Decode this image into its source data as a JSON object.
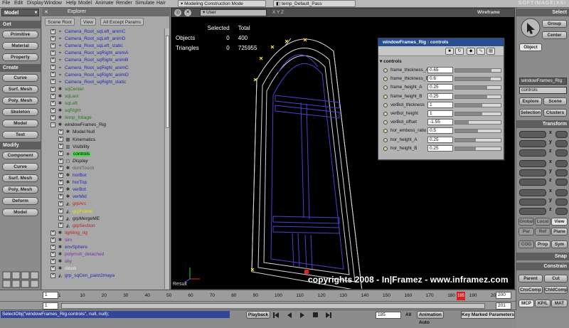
{
  "menubar": {
    "items": [
      "File",
      "Edit",
      "Display",
      "Window",
      "Help",
      "Model",
      "Animate",
      "Render",
      "Simulate",
      "Hair"
    ],
    "mode": "Modeling Construction Mode",
    "pass": "temp_Default_Pass",
    "brand": "SOFTIMAGE|XSI"
  },
  "lefttb": {
    "module": "Model",
    "sections": {
      "get": "Get",
      "create": "Create",
      "modify": "Modify"
    },
    "get_buttons": [
      "Primitive",
      "Material",
      "Property"
    ],
    "create_buttons": [
      "Curve",
      "Surf. Mesh",
      "Poly. Mesh",
      "Skeleton",
      "Model",
      "Text"
    ],
    "modify_buttons": [
      "Component",
      "Curve",
      "Surf. Mesh",
      "Poly. Mesh",
      "Deform",
      "Model"
    ]
  },
  "explorer": {
    "title": "Explorer",
    "tabs": [
      "Scene Root",
      "View",
      "All Except Params"
    ],
    "rows": [
      {
        "label": "Camera_Root_sqLeft_animC",
        "icon": "camera-icon",
        "depth": 0,
        "color": "#2323b8"
      },
      {
        "label": "Camera_Root_sqLeft_animD",
        "icon": "camera-icon",
        "depth": 0,
        "color": "#2323b8"
      },
      {
        "label": "Camera_Root_sqLeft_static",
        "icon": "camera-icon",
        "depth": 0,
        "color": "#2323b8"
      },
      {
        "label": "Camera_Root_sqRight_animA",
        "icon": "camera-icon",
        "depth": 0,
        "color": "#2323b8"
      },
      {
        "label": "Camera_Root_sqRight_animB",
        "icon": "camera-icon",
        "depth": 0,
        "color": "#2323b8"
      },
      {
        "label": "Camera_Root_sqRight_animC",
        "icon": "camera-icon",
        "depth": 0,
        "color": "#2323b8"
      },
      {
        "label": "Camera_Root_sqRight_animD",
        "icon": "camera-icon",
        "depth": 0,
        "color": "#2323b8"
      },
      {
        "label": "Camera_Root_sqRight_static",
        "icon": "camera-icon",
        "depth": 0,
        "color": "#2323b8"
      },
      {
        "label": "sqCenter",
        "icon": "null-icon",
        "depth": 0,
        "color": "#1f7a1f"
      },
      {
        "label": "sqLast",
        "icon": "null-icon",
        "depth": 0,
        "color": "#1f7a1f"
      },
      {
        "label": "sqLeft",
        "icon": "null-icon",
        "depth": 0,
        "color": "#1f7a1f"
      },
      {
        "label": "sqRight",
        "icon": "null-icon",
        "depth": 0,
        "color": "#1f7a1f"
      },
      {
        "label": "temp_foliage",
        "icon": "null-icon",
        "depth": 0,
        "color": "#1f7a1f"
      },
      {
        "label": "windowFrames_Rig",
        "icon": "null-icon",
        "depth": 0,
        "color": "#111111",
        "expanded": true
      },
      {
        "label": "Model Null",
        "icon": "null-icon",
        "depth": 1,
        "color": "#111111"
      },
      {
        "label": "Kinematics",
        "icon": "kinematics-icon",
        "depth": 1,
        "color": "#111111"
      },
      {
        "label": "Visibility",
        "icon": "visibility-icon",
        "depth": 1,
        "color": "#111111"
      },
      {
        "label": "controls",
        "icon": "property-icon",
        "depth": 1,
        "color": "#000000",
        "selected": true
      },
      {
        "label": "Display",
        "icon": "display-icon",
        "depth": 1,
        "color": "#111111",
        "italic": true
      },
      {
        "label": "dontTouch",
        "icon": "null-icon",
        "depth": 1,
        "color": "#5a5a5a"
      },
      {
        "label": "horBot",
        "icon": "null-icon",
        "depth": 1,
        "color": "#2323b8"
      },
      {
        "label": "horTop",
        "icon": "null-icon",
        "depth": 1,
        "color": "#2323b8"
      },
      {
        "label": "verBot",
        "icon": "null-icon",
        "depth": 1,
        "color": "#2323b8"
      },
      {
        "label": "verMid",
        "icon": "null-icon",
        "depth": 1,
        "color": "#2323b8"
      },
      {
        "label": "grpArc",
        "icon": "group-icon",
        "depth": 1,
        "color": "#c02020"
      },
      {
        "label": "grpFrame",
        "icon": "group-icon",
        "depth": 1,
        "color": "#e6e000"
      },
      {
        "label": "grpMergeME",
        "icon": "group-icon",
        "depth": 1,
        "color": "#111111"
      },
      {
        "label": "grpSection",
        "icon": "group-icon",
        "depth": 1,
        "color": "#c02020"
      },
      {
        "label": "lighting_rig",
        "icon": "null-icon",
        "depth": 0,
        "color": "#c02020"
      },
      {
        "label": "sim",
        "icon": "null-icon",
        "depth": 0,
        "color": "#7a2fb0"
      },
      {
        "label": "envSphere",
        "icon": "null-icon",
        "depth": 0,
        "color": "#2323b8"
      },
      {
        "label": "polymsh_detached",
        "icon": "null-icon",
        "depth": 0,
        "color": "#7a2fb0"
      },
      {
        "label": "sky",
        "icon": "null-icon",
        "depth": 0,
        "color": "#7a2fb0"
      },
      {
        "label": "cloud",
        "icon": "null-icon",
        "depth": 0,
        "color": "#f0f0f0"
      },
      {
        "label": "grp_sqCen_paint2maya",
        "icon": "group-icon",
        "depth": 0,
        "color": "#2323b8"
      }
    ]
  },
  "viewport": {
    "camera": "User",
    "shading": "Wireframe",
    "stats": {
      "col1": "Selected",
      "col2": "Total",
      "rows": [
        [
          "Objects",
          "0",
          "400"
        ],
        [
          "Triangles",
          "0",
          "725955"
        ]
      ]
    },
    "copyright": "copyrights 2008 - In|Framez - www.inframez.com",
    "result_label": "Result"
  },
  "ppg": {
    "title": "windowFrames_Rig : controls",
    "section": "controls",
    "params": [
      {
        "name": "frame_thickness_A",
        "value": "0.65",
        "level": 0.8
      },
      {
        "name": "frame_thickness_B",
        "value": "0.6",
        "level": 0.78
      },
      {
        "name": "frame_height_A",
        "value": "0.25",
        "level": 0.7
      },
      {
        "name": "frame_height_B",
        "value": "0.25",
        "level": 0.7
      },
      {
        "name": "verBot_thickness",
        "value": "1",
        "level": 0.6
      },
      {
        "name": "verBot_height",
        "value": "1",
        "level": 0.6
      },
      {
        "name": "verBot_offset",
        "value": "-1.55",
        "level": 0.3
      },
      {
        "name": "hor_emboss_ratio",
        "value": "0.5",
        "level": 0.5
      },
      {
        "name": "hor_height_A",
        "value": "0.25",
        "level": 0.45
      },
      {
        "name": "hor_height_B",
        "value": "0.25",
        "level": 0.45
      }
    ]
  },
  "right": {
    "select_title": "Select",
    "group": "Group",
    "center": "Center",
    "object": "Object",
    "selected_name": "windowFrames_Rig",
    "selected_prop": "controls",
    "explore": "Explore",
    "scene": "Scene",
    "selection": "Selection",
    "clusters": "Clusters",
    "transform": "Transform",
    "axes": [
      "x",
      "y",
      "z"
    ],
    "global": "Global",
    "local": "Local",
    "view": "View",
    "par": "Par",
    "ref": "Ref",
    "plane": "Plane",
    "cog": "COG",
    "prop": "Prop",
    "sym": "Sym",
    "snap": "Snap",
    "constrain": "Constrain",
    "parent": "Parent",
    "cut": "Cut",
    "cnscomp": "CnsComp",
    "childcomp": "ChldComp",
    "mcp": "MCP",
    "kpl": "KP/L",
    "mat": "MAT"
  },
  "timeline": {
    "start": "1",
    "end": "200",
    "current": "185",
    "ticks": [
      "1",
      "10",
      "20",
      "30",
      "40",
      "50",
      "60",
      "70",
      "80",
      "90",
      "100",
      "110",
      "120",
      "130",
      "140",
      "150",
      "160",
      "170",
      "180",
      "190",
      "200"
    ],
    "end2": "201",
    "start2": "1"
  },
  "bottom": {
    "command": "SelectObj(\"windowFrames_Rig.controls\", null, null);",
    "playback": "Playback",
    "frame": "185",
    "all": "All",
    "animation": "Animation",
    "auto": "Auto",
    "key_marked": "Key Marked Parameters"
  }
}
